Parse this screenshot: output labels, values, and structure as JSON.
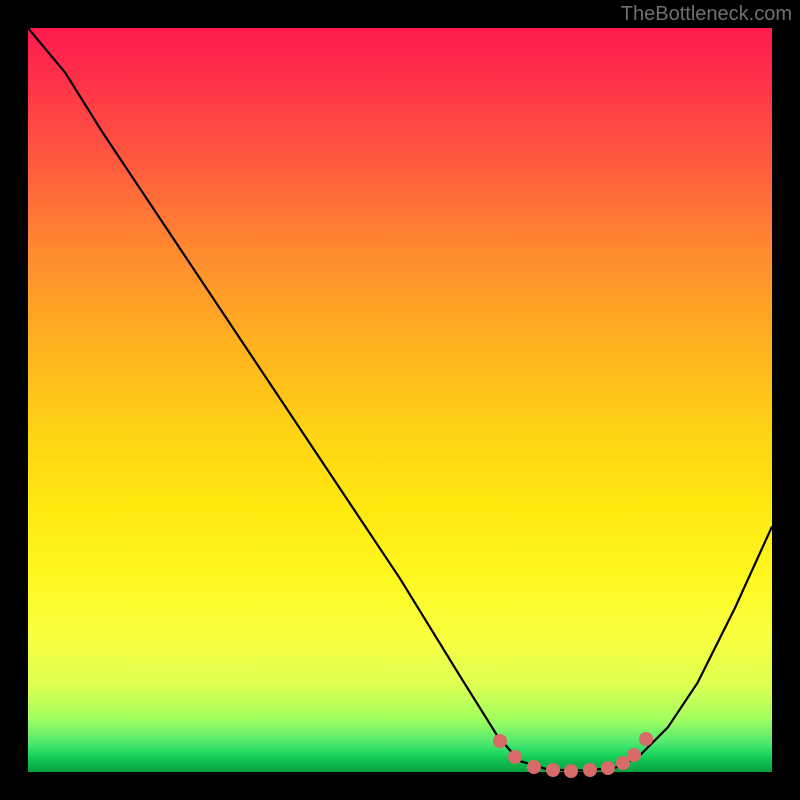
{
  "watermark": "TheBottleneck.com",
  "chart_data": {
    "type": "line",
    "title": "",
    "xlabel": "",
    "ylabel": "",
    "x_range": [
      0,
      100
    ],
    "y_range": [
      0,
      100
    ],
    "curve_points": [
      {
        "x": 0,
        "y": 100
      },
      {
        "x": 5,
        "y": 94
      },
      {
        "x": 10,
        "y": 86
      },
      {
        "x": 20,
        "y": 71
      },
      {
        "x": 30,
        "y": 56
      },
      {
        "x": 40,
        "y": 41
      },
      {
        "x": 50,
        "y": 26
      },
      {
        "x": 58,
        "y": 13
      },
      {
        "x": 63,
        "y": 5
      },
      {
        "x": 66,
        "y": 1.5
      },
      {
        "x": 70,
        "y": 0.3
      },
      {
        "x": 75,
        "y": 0.2
      },
      {
        "x": 79,
        "y": 0.6
      },
      {
        "x": 82,
        "y": 2
      },
      {
        "x": 86,
        "y": 6
      },
      {
        "x": 90,
        "y": 12
      },
      {
        "x": 95,
        "y": 22
      },
      {
        "x": 100,
        "y": 33
      }
    ],
    "markers": [
      {
        "x": 63.5,
        "y": 4.2
      },
      {
        "x": 65.5,
        "y": 2.0
      },
      {
        "x": 68.0,
        "y": 0.7
      },
      {
        "x": 70.5,
        "y": 0.3
      },
      {
        "x": 73.0,
        "y": 0.2
      },
      {
        "x": 75.5,
        "y": 0.25
      },
      {
        "x": 78.0,
        "y": 0.5
      },
      {
        "x": 80.0,
        "y": 1.2
      },
      {
        "x": 81.5,
        "y": 2.3
      },
      {
        "x": 83.0,
        "y": 4.5
      }
    ],
    "gradient_note": "vertical gradient red (top) to green (bottom) representing bottleneck severity"
  }
}
